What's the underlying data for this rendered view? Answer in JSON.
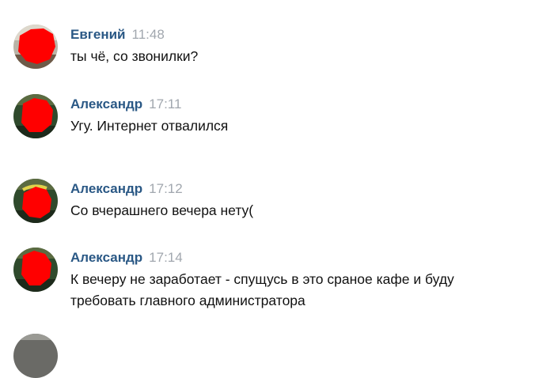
{
  "messages": [
    {
      "author": "Евгений",
      "time": "11:48",
      "avatar_icon": "user-avatar-icon",
      "lines": [
        "ты чё, со звонилки?"
      ]
    },
    {
      "author": "Александр",
      "time": "17:11",
      "avatar_icon": "user-avatar-icon",
      "lines": [
        "Угу. Интернет отвалился"
      ]
    },
    {
      "author": "Александр",
      "time": "17:12",
      "avatar_icon": "user-avatar-icon",
      "lines": [
        "Со вчерашнего вечера нету("
      ]
    },
    {
      "author": "Александр",
      "time": "17:14",
      "avatar_icon": "user-avatar-icon",
      "lines": [
        "К вечеру не заработает - спущусь в это сраное кафе и буду",
        "требовать главного администратора"
      ]
    }
  ],
  "colors": {
    "author": "#2a5885",
    "time": "#a1a7ae",
    "text": "#111111",
    "avatar_censor": "#ff0000"
  }
}
